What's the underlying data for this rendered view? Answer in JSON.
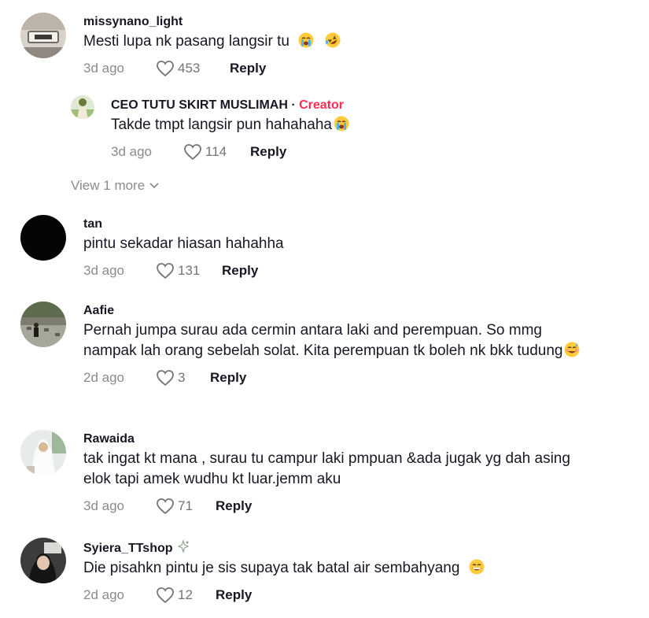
{
  "comments": [
    {
      "username": "missynano_light",
      "text": "Mesti lupa nk pasang langsir tu",
      "emojis": [
        "crying-face",
        "rolling-laughing-face"
      ],
      "time": "3d ago",
      "likes": "453",
      "reply_label": "Reply"
    },
    {
      "username": "tan",
      "text": "pintu sekadar hiasan hahahha",
      "time": "3d ago",
      "likes": "131",
      "reply_label": "Reply"
    },
    {
      "username": "Aafie",
      "text": "Pernah jumpa surau ada cermin antara laki and perempuan. So mmg nampak lah orang sebelah solat. Kita perempuan tk boleh nk bkk tudung",
      "emojis": [
        "sweat-smile-face"
      ],
      "time": "2d ago",
      "likes": "3",
      "reply_label": "Reply"
    },
    {
      "username": "Rawaida",
      "text": "tak ingat kt mana , surau tu campur laki pmpuan &ada jugak yg dah asing elok tapi amek wudhu kt luar.jemm aku",
      "time": "3d ago",
      "likes": "71",
      "reply_label": "Reply"
    },
    {
      "username": "Syiera_TTshop",
      "text": "Die pisahkn pintu je sis supaya tak batal air sembahyang",
      "emojis": [
        "grinning-face"
      ],
      "time": "2d ago",
      "likes": "12",
      "reply_label": "Reply"
    }
  ],
  "reply": {
    "username": "CEO TUTU SKIRT MUSLIMAH",
    "separator": " · ",
    "creator_label": "Creator",
    "text": "Takde tmpt langsir pun hahahaha",
    "emojis": [
      "crying-face"
    ],
    "time": "3d ago",
    "likes": "114",
    "reply_label": "Reply"
  },
  "view_more_label": "View 1 more",
  "icons": {
    "like": "heart-outline-icon",
    "view_more": "chevron-down-icon",
    "username_badge": "sparkle-badge-icon"
  },
  "colors": {
    "creator": "#fe2c55",
    "meta": "#8a8b91",
    "text": "#161823"
  }
}
